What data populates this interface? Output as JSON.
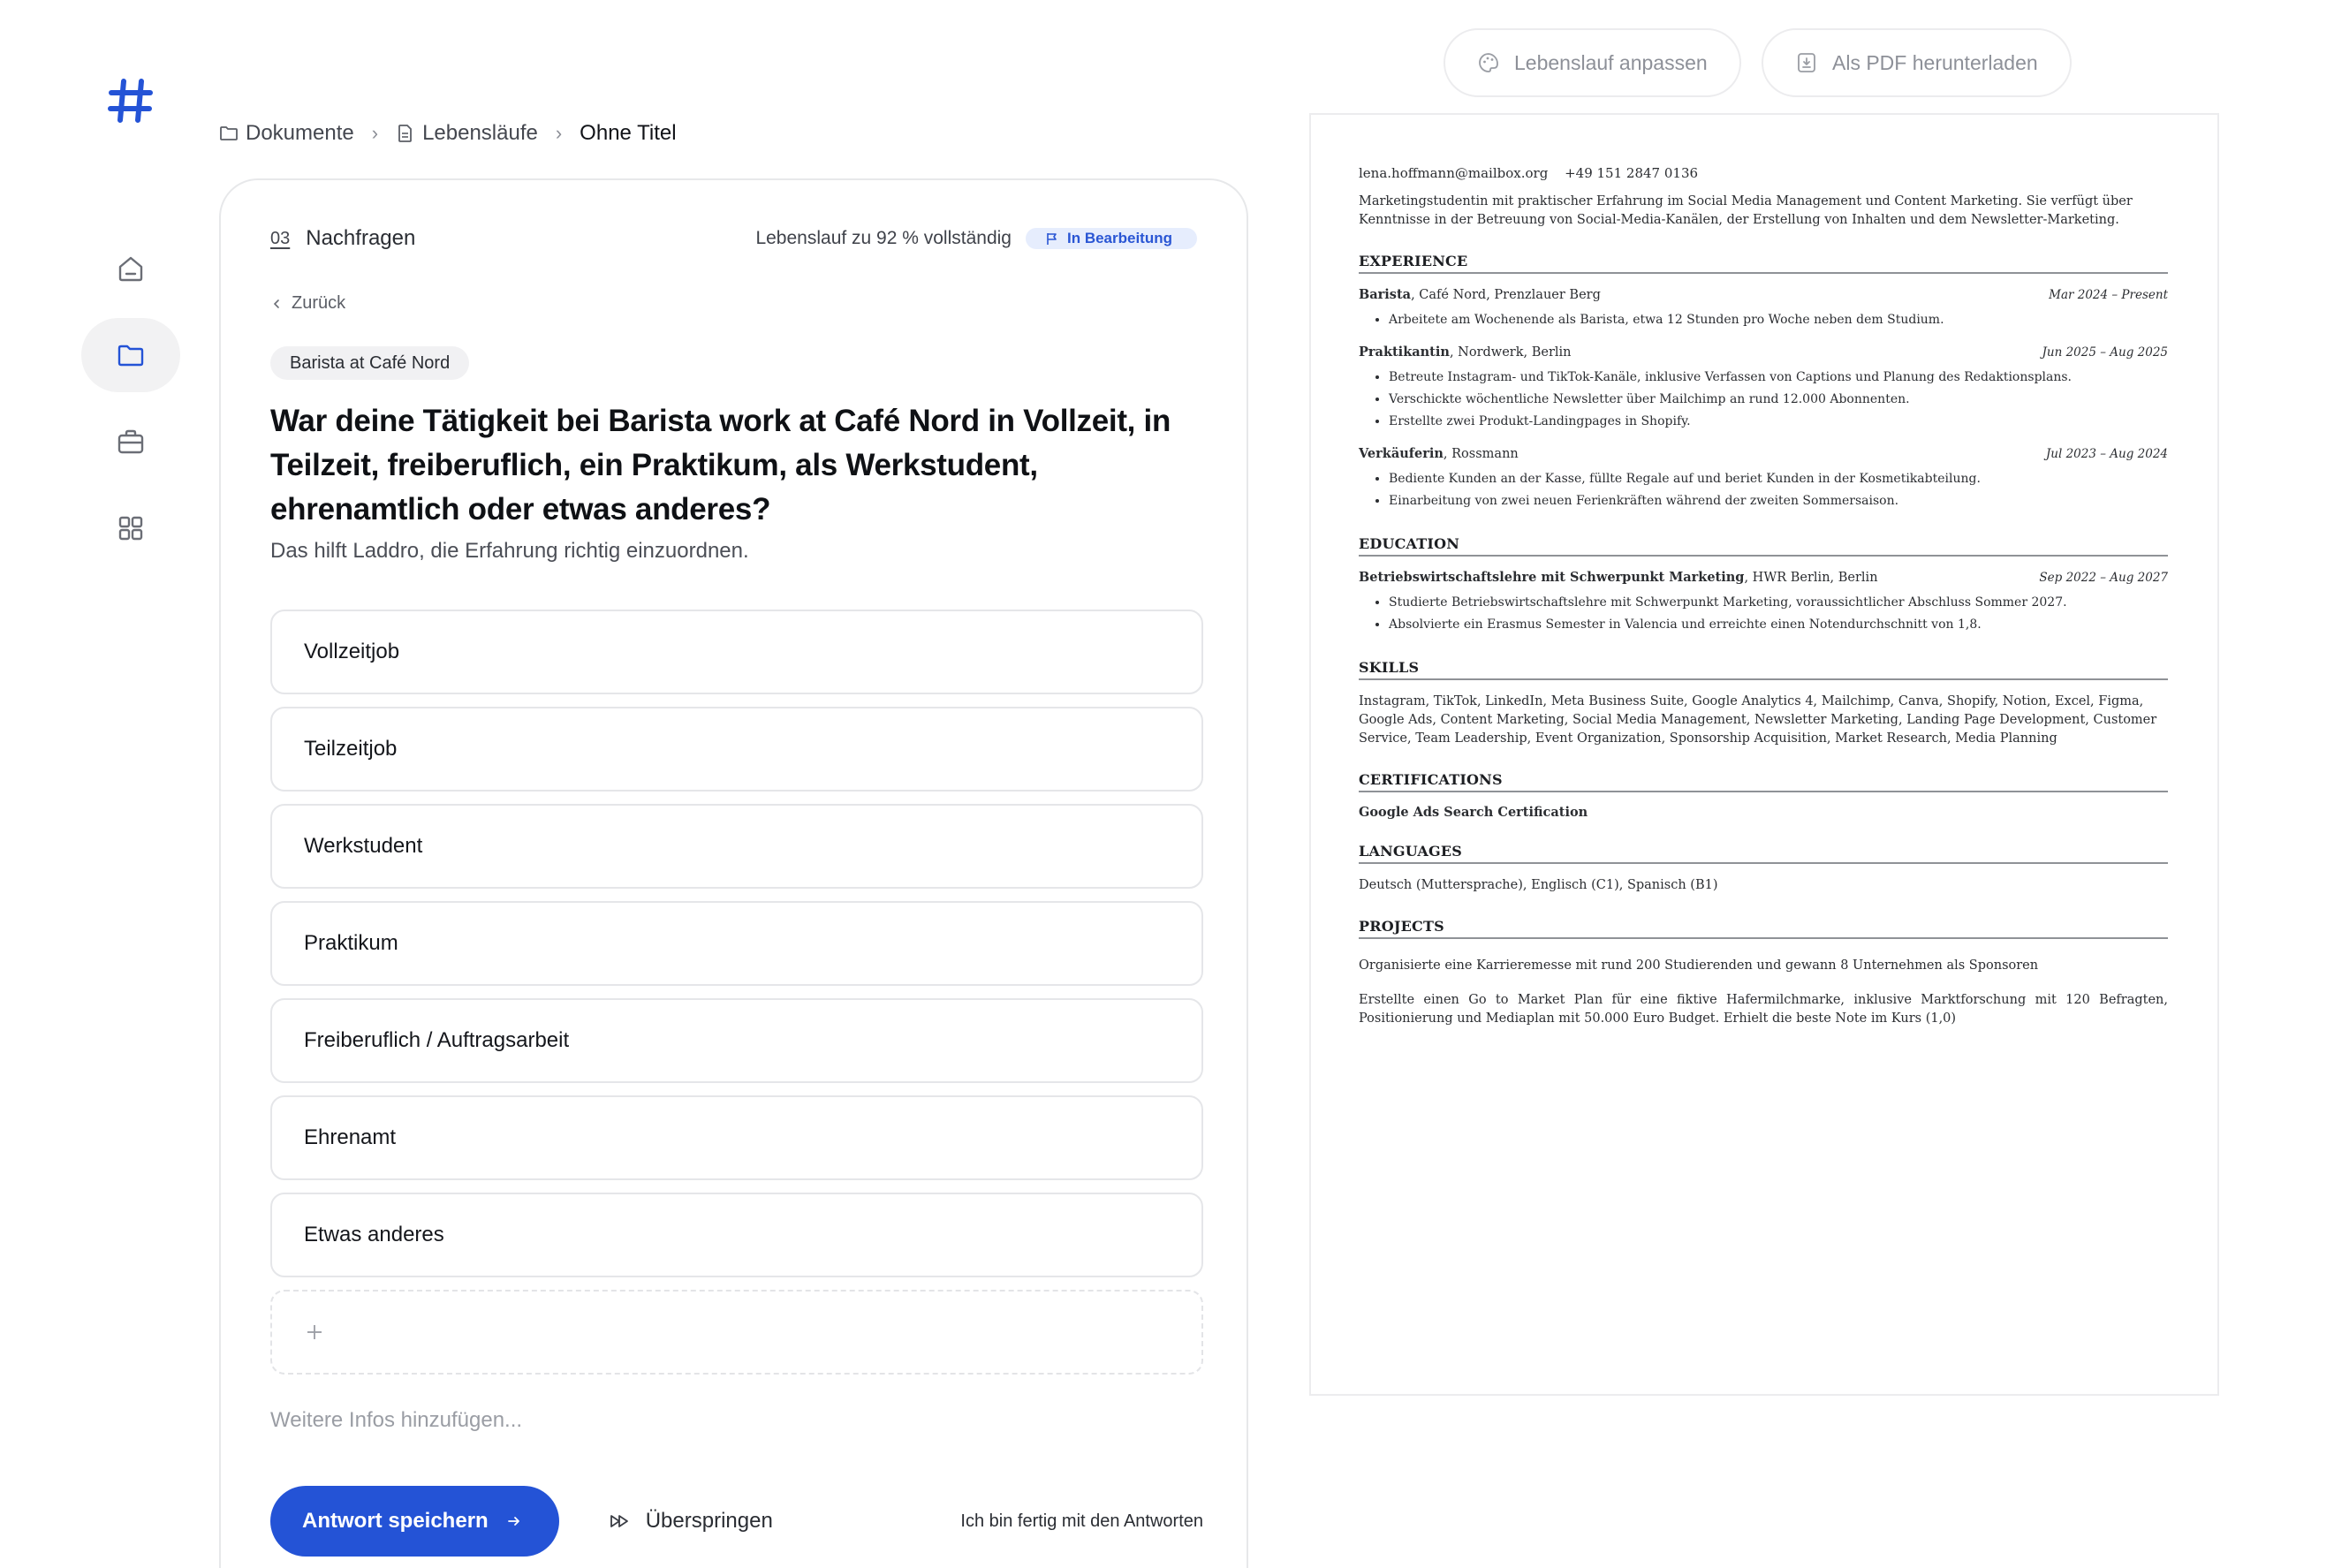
{
  "breadcrumb": {
    "documents": "Dokumente",
    "resumes": "Lebensläufe",
    "current": "Ohne Titel"
  },
  "top_actions": {
    "customize": "Lebenslauf anpassen",
    "download": "Als PDF herunterladen"
  },
  "step": {
    "number": "03",
    "title": "Nachfragen",
    "progress": "Lebenslauf zu 92 % vollständig",
    "status": "In Bearbeitung"
  },
  "back_label": "Zurück",
  "context_tag": "Barista at Café Nord",
  "question": "War deine Tätigkeit bei Barista work at Café Nord in Vollzeit, in Teilzeit, freiberuflich, ein Praktikum, als Werkstudent, ehrenamtlich oder etwas anderes?",
  "hint": "Das hilft Laddro, die Erfahrung richtig einzuordnen.",
  "options": [
    "Vollzeitjob",
    "Teilzeitjob",
    "Werkstudent",
    "Praktikum",
    "Freiberuflich / Auftragsarbeit",
    "Ehrenamt",
    "Etwas anderes"
  ],
  "more_info_placeholder": "Weitere Infos hinzufügen...",
  "actions": {
    "save": "Antwort speichern",
    "skip": "Überspringen",
    "done": "Ich bin fertig mit den Antworten"
  },
  "resume": {
    "email": "lena.hoffmann@mailbox.org",
    "phone": "+49 151 2847 0136",
    "summary": "Marketingstudentin mit praktischer Erfahrung im Social Media Management und Content Marketing. Sie verfügt über Kenntnisse in der Betreuung von Social-Media-Kanälen, der Erstellung von Inhalten und dem Newsletter-Marketing.",
    "sections": {
      "experience": "EXPERIENCE",
      "education": "EDUCATION",
      "skills": "SKILLS",
      "certifications": "CERTIFICATIONS",
      "languages": "LANGUAGES",
      "projects": "PROJECTS"
    },
    "experience": [
      {
        "role": "Barista",
        "org": ", Café Nord, Prenzlauer Berg",
        "date": "Mar 2024 – Present",
        "bullets": [
          "Arbeitete am Wochenende als Barista, etwa 12 Stunden pro Woche neben dem Studium."
        ]
      },
      {
        "role": "Praktikantin",
        "org": ", Nordwerk, Berlin",
        "date": "Jun 2025 – Aug 2025",
        "bullets": [
          "Betreute Instagram- und TikTok-Kanäle, inklusive Verfassen von Captions und Planung des Redaktionsplans.",
          "Verschickte wöchentliche Newsletter über Mailchimp an rund 12.000 Abonnenten.",
          "Erstellte zwei Produkt-Landingpages in Shopify."
        ]
      },
      {
        "role": "Verkäuferin",
        "org": ", Rossmann",
        "date": "Jul 2023 – Aug 2024",
        "bullets": [
          "Bediente Kunden an der Kasse, füllte Regale auf und beriet Kunden in der Kosmetikabteilung.",
          "Einarbeitung von zwei neuen Ferienkräften während der zweiten Sommersaison."
        ]
      }
    ],
    "education": {
      "degree": "Betriebswirtschaftslehre mit Schwerpunkt Marketing",
      "school": ", HWR Berlin, Berlin",
      "date": "Sep 2022 – Aug 2027",
      "bullets": [
        "Studierte Betriebswirtschaftslehre mit Schwerpunkt Marketing, voraussichtlicher Abschluss Sommer 2027.",
        "Absolvierte ein Erasmus Semester in Valencia und erreichte einen Notendurchschnitt von 1,8."
      ]
    },
    "skills": "Instagram, TikTok, LinkedIn, Meta Business Suite, Google Analytics 4, Mailchimp, Canva, Shopify, Notion, Excel, Figma, Google Ads, Content Marketing, Social Media Management, Newsletter Marketing, Landing Page Development, Customer Service, Team Leadership, Event Organization, Sponsorship Acquisition, Market Research, Media Planning",
    "certification": "Google Ads Search Certification",
    "languages": "Deutsch (Muttersprache), Englisch (C1), Spanisch (B1)",
    "projects": [
      "Organisierte eine Karrieremesse mit rund 200 Studierenden und gewann 8 Unternehmen als Sponsoren",
      "Erstellte einen Go to Market Plan für eine fiktive Hafermilchmarke, inklusive Marktforschung mit 120 Befragten, Positionierung und Mediaplan mit 50.000 Euro Budget. Erhielt die beste Note im Kurs (1,0)"
    ]
  }
}
